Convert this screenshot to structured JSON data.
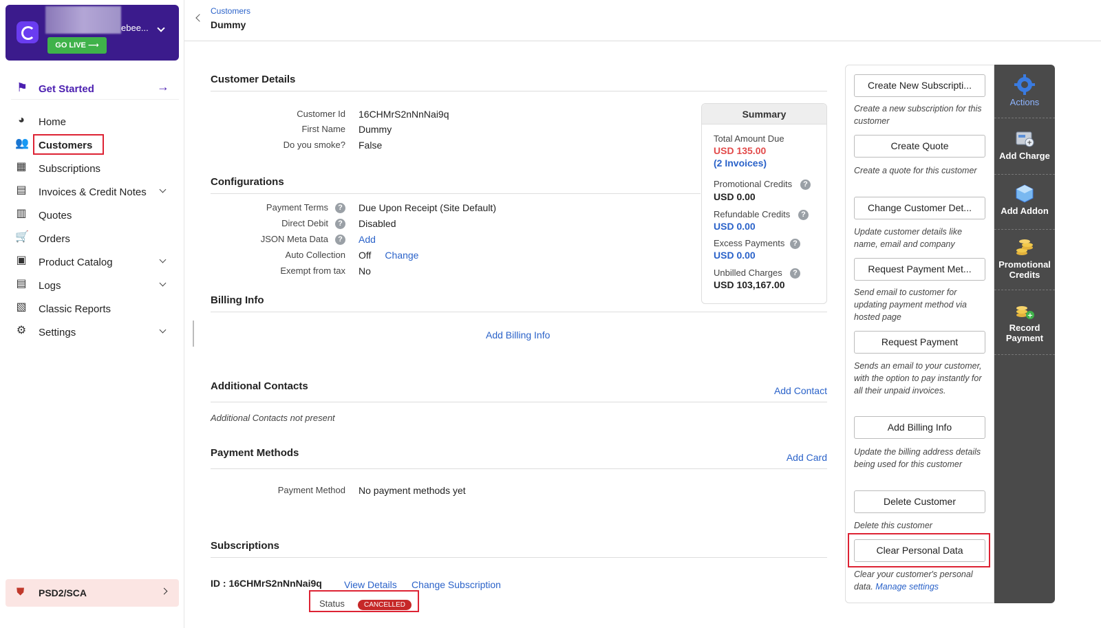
{
  "org": {
    "name": "ebee...",
    "go_live": "GO LIVE ⟶"
  },
  "get_started": {
    "label": "Get Started"
  },
  "nav": {
    "home": "Home",
    "customers": "Customers",
    "subscriptions": "Subscriptions",
    "invoices": "Invoices & Credit Notes",
    "quotes": "Quotes",
    "orders": "Orders",
    "product_catalog": "Product Catalog",
    "logs": "Logs",
    "classic_reports": "Classic Reports",
    "settings": "Settings"
  },
  "psd": {
    "label": "PSD2/SCA"
  },
  "header": {
    "breadcrumb": "Customers",
    "title": "Dummy"
  },
  "customer_details": {
    "title": "Customer Details",
    "id_label": "Customer Id",
    "id_value": "16CHMrS2nNnNai9q",
    "first_name_label": "First Name",
    "first_name_value": "Dummy",
    "smoke_label": "Do you smoke?",
    "smoke_value": "False"
  },
  "configurations": {
    "title": "Configurations",
    "payment_terms_label": "Payment Terms",
    "payment_terms_value": "Due Upon Receipt (Site Default)",
    "direct_debit_label": "Direct Debit",
    "direct_debit_value": "Disabled",
    "json_meta_label": "JSON Meta Data",
    "json_meta_action": "Add",
    "auto_collection_label": "Auto Collection",
    "auto_collection_value": "Off",
    "auto_collection_action": "Change",
    "exempt_label": "Exempt from tax",
    "exempt_value": "No"
  },
  "billing_info": {
    "title": "Billing Info",
    "action": "Add Billing Info"
  },
  "additional_contacts": {
    "title": "Additional Contacts",
    "action": "Add Contact",
    "empty": "Additional Contacts not present"
  },
  "payment_methods": {
    "title": "Payment Methods",
    "action": "Add Card",
    "label": "Payment Method",
    "value": "No payment methods yet"
  },
  "subscriptions": {
    "title": "Subscriptions",
    "id_text": "ID : 16CHMrS2nNnNai9q",
    "view_details": "View Details",
    "change": "Change Subscription",
    "status_label": "Status",
    "status_value": "CANCELLED"
  },
  "summary": {
    "title": "Summary",
    "total_due_label": "Total Amount Due",
    "total_due_value": "USD 135.00",
    "invoices_link": "(2 Invoices)",
    "promo_label": "Promotional Credits",
    "promo_value": "USD 0.00",
    "refundable_label": "Refundable Credits",
    "refundable_value": "USD 0.00",
    "excess_label": "Excess Payments",
    "excess_value": "USD 0.00",
    "unbilled_label": "Unbilled Charges",
    "unbilled_value": "USD 103,167.00"
  },
  "actions": {
    "create_sub": "Create New Subscripti...",
    "create_sub_desc": "Create a new subscription for this customer",
    "create_quote": "Create Quote",
    "create_quote_desc": "Create a quote for this customer",
    "change_details": "Change Customer Det...",
    "change_details_desc": "Update customer details like name, email and company",
    "request_pm": "Request Payment Met...",
    "request_pm_desc": "Send email to customer for updating payment method via hosted page",
    "request_payment": "Request Payment",
    "request_payment_desc": "Sends an email to your customer, with the option to pay instantly for all their unpaid invoices.",
    "add_billing": "Add Billing Info",
    "add_billing_desc": "Update the billing address details being used for this customer",
    "delete": "Delete Customer",
    "delete_desc": "Delete this customer",
    "clear": "Clear Personal Data",
    "clear_desc": "Clear your customer's personal data.",
    "manage_settings": "Manage settings"
  },
  "tabs": {
    "actions": "Actions",
    "add_charge": "Add Charge",
    "add_addon": "Add Addon",
    "promo_credits": "Promotional Credits",
    "record_payment": "Record Payment"
  }
}
